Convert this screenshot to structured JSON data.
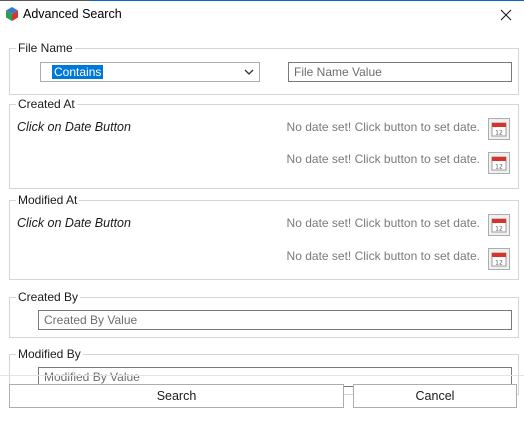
{
  "window": {
    "title": "Advanced Search",
    "app_icon": "app-cube-icon",
    "close_icon": "close-icon"
  },
  "file_name": {
    "legend": "File Name",
    "match_mode": "Contains",
    "value_placeholder": "File Name Value",
    "value": ""
  },
  "created_at": {
    "legend": "Created At",
    "hint": "Click on Date Button",
    "from_date_text": "No date set! Click button to set date.",
    "to_date_text": "No date set! Click button to set date.",
    "date_button_icon": "calendar-icon"
  },
  "modified_at": {
    "legend": "Modified At",
    "hint": "Click on Date Button",
    "from_date_text": "No date set! Click button to set date.",
    "to_date_text": "No date set! Click button to set date.",
    "date_button_icon": "calendar-icon"
  },
  "created_by": {
    "legend": "Created By",
    "placeholder": "Created By Value",
    "value": ""
  },
  "modified_by": {
    "legend": "Modified By",
    "placeholder": "Modified By Value",
    "value": ""
  },
  "actions": {
    "search_label": "Search",
    "cancel_label": "Cancel"
  },
  "colors": {
    "accent": "#0078d7",
    "calendar_red": "#d9312b",
    "group_border": "#d4d4d4"
  }
}
